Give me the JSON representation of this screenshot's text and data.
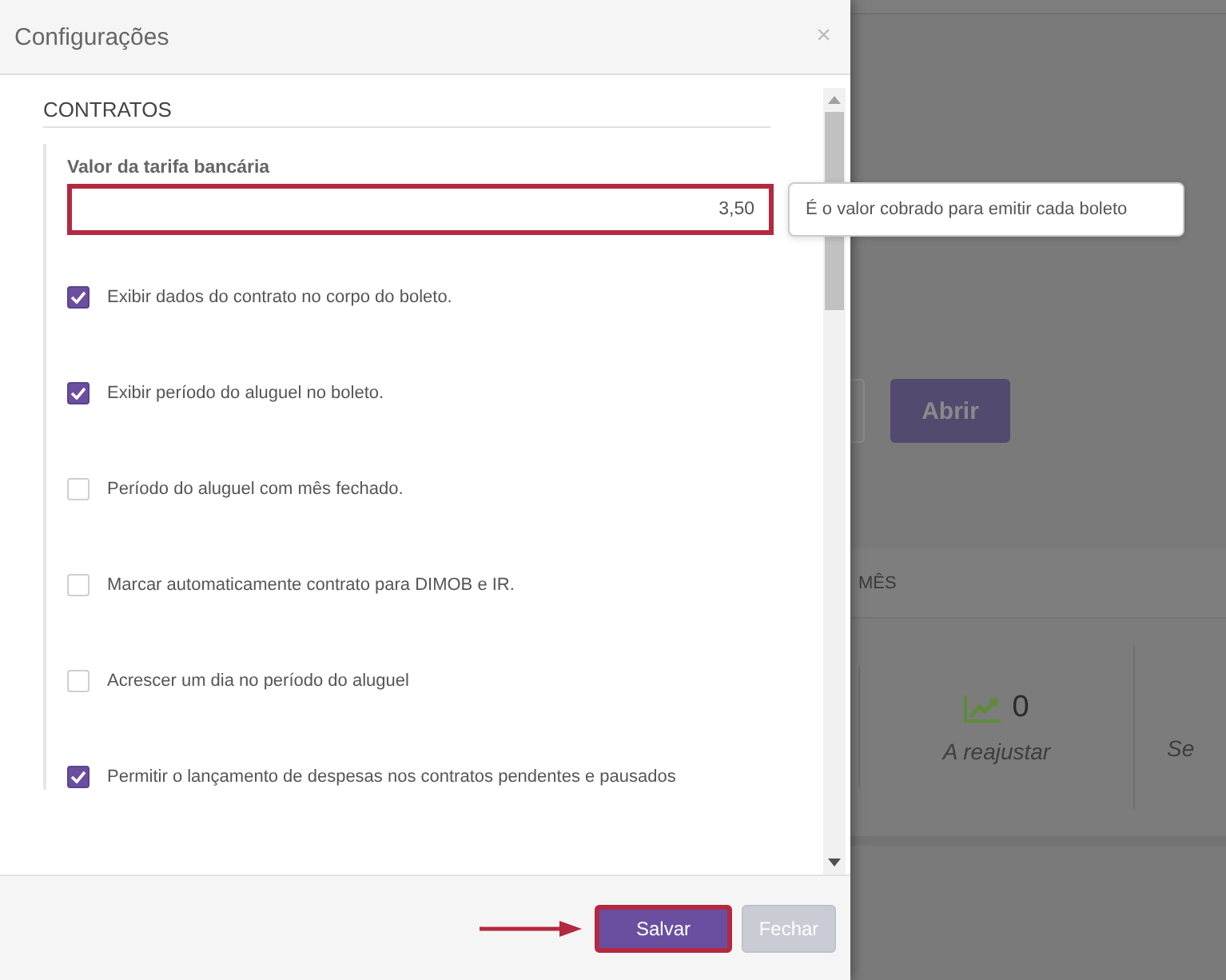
{
  "background_page": {
    "open_button": "Abrir",
    "section_title": "MÊS",
    "stats": [
      {
        "value": "0",
        "label": "A reajustar"
      },
      {
        "label": "Se"
      }
    ]
  },
  "dialog": {
    "title": "Configurações",
    "close": "×",
    "section": "CONTRATOS",
    "fee_field": {
      "label": "Valor da tarifa bancária",
      "value": "3,50",
      "tooltip": "É o valor cobrado para emitir cada boleto"
    },
    "options": [
      {
        "label": "Exibir dados do contrato no corpo do boleto.",
        "checked": true
      },
      {
        "label": "Exibir período do aluguel no boleto.",
        "checked": true
      },
      {
        "label": "Período do aluguel com mês fechado.",
        "checked": false
      },
      {
        "label": "Marcar automaticamente contrato para DIMOB e IR.",
        "checked": false
      },
      {
        "label": "Acrescer um dia no período do aluguel",
        "checked": false
      },
      {
        "label": "Permitir o lançamento de despesas nos contratos pendentes e pausados",
        "checked": true
      }
    ],
    "buttons": [
      {
        "label": "Salvar",
        "kind": "primary"
      },
      {
        "label": "Fechar",
        "kind": "secondary"
      }
    ]
  }
}
